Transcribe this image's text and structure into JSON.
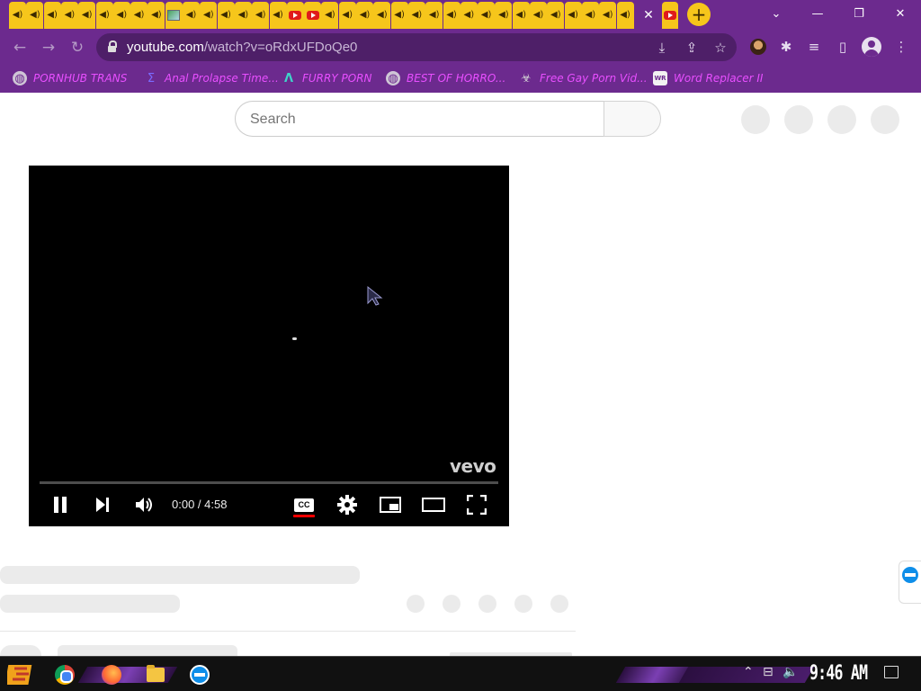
{
  "browser": {
    "tab_count_inactive": 36,
    "active_tab": {
      "close_glyph": "✕"
    },
    "new_tab_glyph": "+",
    "window_controls": {
      "minimize": "—",
      "restore": "❐",
      "close": "✕",
      "tabsearch": "⌄"
    },
    "url": {
      "host": "youtube.com",
      "path": "/watch?v=oRdxUFDoQe0"
    },
    "nav": {
      "back": "←",
      "forward": "→",
      "reload": "↻"
    },
    "omnibox_icons": {
      "install": "⤓",
      "share": "⇪",
      "bookmark": "☆"
    },
    "toolbar_icons": {
      "extensions": "✱",
      "media": "≡",
      "sidepanel": "▯",
      "menu": "⋮"
    }
  },
  "bookmarks": [
    {
      "label": "PORNHUB TRANS",
      "icon": "globe-icon",
      "glyph": "◍"
    },
    {
      "label": "Anal Prolapse Time...",
      "icon": "sigma-icon",
      "glyph": "Σ"
    },
    {
      "label": "FURRY PORN",
      "icon": "lambda-icon",
      "glyph": "Λ"
    },
    {
      "label": "BEST OF HORRO...",
      "icon": "globe-icon",
      "glyph": "◍"
    },
    {
      "label": "Free Gay Porn Vid...",
      "icon": "biohazard-icon",
      "glyph": "☣"
    },
    {
      "label": "Word Replacer II",
      "icon": "wr-icon",
      "glyph": "WR"
    }
  ],
  "youtube": {
    "search": {
      "placeholder": "Search"
    },
    "player": {
      "watermark": "vevo",
      "time": "0:00 / 4:58",
      "progress": 0.0,
      "cc_label": "CC"
    }
  },
  "taskbar": {
    "clock": "9:46 AM",
    "tray": {
      "up": "⌃",
      "network": "⊟",
      "volume": "🔈"
    }
  }
}
